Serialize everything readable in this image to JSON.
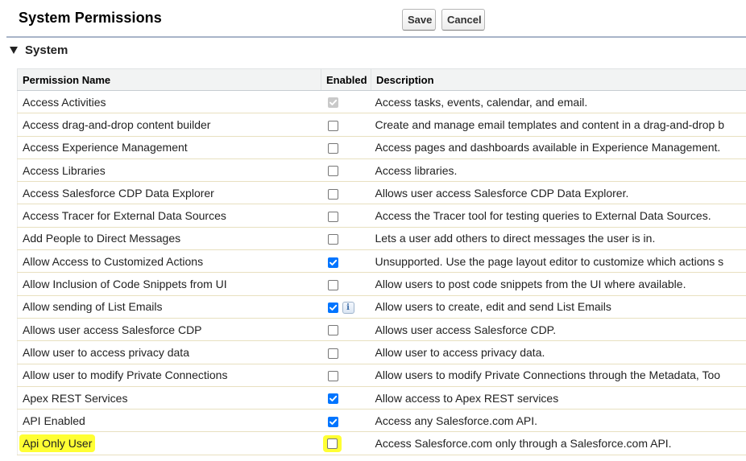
{
  "header": {
    "title": "System Permissions",
    "save_label": "Save",
    "cancel_label": "Cancel"
  },
  "section": {
    "title": "System"
  },
  "table": {
    "columns": [
      "Permission Name",
      "Enabled",
      "Description"
    ],
    "rows": [
      {
        "name": "Access Activities",
        "enabled": true,
        "disabled": true,
        "info": false,
        "highlight": false,
        "description": "Access tasks, events, calendar, and email."
      },
      {
        "name": "Access drag-and-drop content builder",
        "enabled": false,
        "disabled": false,
        "info": false,
        "highlight": false,
        "description": "Create and manage email templates and content in a drag-and-drop b"
      },
      {
        "name": "Access Experience Management",
        "enabled": false,
        "disabled": false,
        "info": false,
        "highlight": false,
        "description": "Access pages and dashboards available in Experience Management."
      },
      {
        "name": "Access Libraries",
        "enabled": false,
        "disabled": false,
        "info": false,
        "highlight": false,
        "description": "Access libraries."
      },
      {
        "name": "Access Salesforce CDP Data Explorer",
        "enabled": false,
        "disabled": false,
        "info": false,
        "highlight": false,
        "description": "Allows user access Salesforce CDP Data Explorer."
      },
      {
        "name": "Access Tracer for External Data Sources",
        "enabled": false,
        "disabled": false,
        "info": false,
        "highlight": false,
        "description": "Access the Tracer tool for testing queries to External Data Sources."
      },
      {
        "name": "Add People to Direct Messages",
        "enabled": false,
        "disabled": false,
        "info": false,
        "highlight": false,
        "description": "Lets a user add others to direct messages the user is in."
      },
      {
        "name": "Allow Access to Customized Actions",
        "enabled": true,
        "disabled": false,
        "info": false,
        "highlight": false,
        "description": "Unsupported. Use the page layout editor to customize which actions s"
      },
      {
        "name": "Allow Inclusion of Code Snippets from UI",
        "enabled": false,
        "disabled": false,
        "info": false,
        "highlight": false,
        "description": "Allow users to post code snippets from the UI where available."
      },
      {
        "name": "Allow sending of List Emails",
        "enabled": true,
        "disabled": false,
        "info": true,
        "highlight": false,
        "description": "Allow users to create, edit and send List Emails"
      },
      {
        "name": "Allows user access Salesforce CDP",
        "enabled": false,
        "disabled": false,
        "info": false,
        "highlight": false,
        "description": "Allows user access Salesforce CDP."
      },
      {
        "name": "Allow user to access privacy data",
        "enabled": false,
        "disabled": false,
        "info": false,
        "highlight": false,
        "description": "Allow user to access privacy data."
      },
      {
        "name": "Allow user to modify Private Connections",
        "enabled": false,
        "disabled": false,
        "info": false,
        "highlight": false,
        "description": "Allow users to modify Private Connections through the Metadata, Too"
      },
      {
        "name": "Apex REST Services",
        "enabled": true,
        "disabled": false,
        "info": false,
        "highlight": false,
        "description": "Allow access to Apex REST services"
      },
      {
        "name": "API Enabled",
        "enabled": true,
        "disabled": false,
        "info": false,
        "highlight": false,
        "description": "Access any Salesforce.com API."
      },
      {
        "name": "Api Only User",
        "enabled": false,
        "disabled": false,
        "info": false,
        "highlight": true,
        "description": "Access Salesforce.com only through a Salesforce.com API."
      }
    ]
  }
}
